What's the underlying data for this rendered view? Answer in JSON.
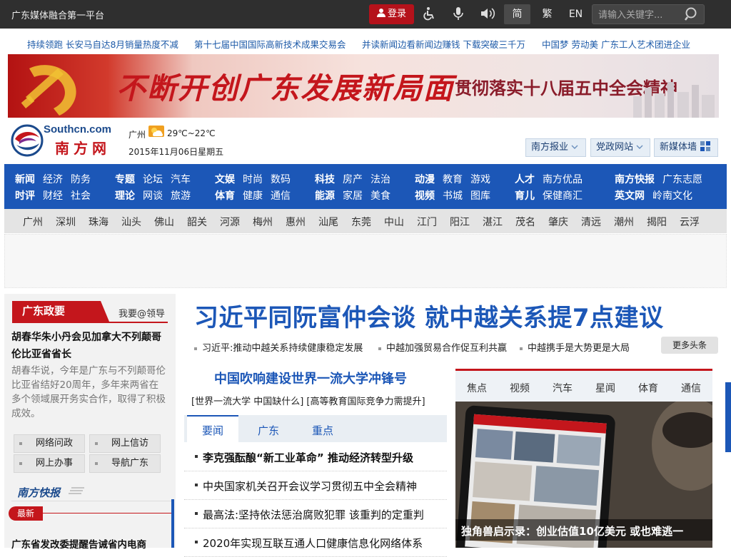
{
  "topbar": {
    "site_name": "广东媒体融合第一平台",
    "login_label": "登录",
    "icons": [
      "accessibility-icon",
      "microphone-icon",
      "speaker-icon"
    ],
    "lang_simplified": "简",
    "lang_traditional": "繁",
    "lang_english": "EN",
    "search_placeholder": "请输入关键字...",
    "bg_color": "#2f2f2f",
    "login_color": "#b5121b"
  },
  "ticker": [
    "持续领跑 长安马自达8月销量热度不减",
    "第十七届中国国际高新技术成果交易会",
    "并读新闻边看新闻边赚钱 下载突破三千万",
    "中国梦 劳动美 广东工人艺术团进企业"
  ],
  "banner": {
    "headline": "不断开创广东发展新局面",
    "subheadline": "贯彻落实十八届五中全会精神"
  },
  "logo": {
    "en": "Southcn.com",
    "cn": "南方网"
  },
  "weather": {
    "city": "广州",
    "temp": "29℃~22℃",
    "date": "2015年11月06日星期五"
  },
  "dropdowns": {
    "nanfang_newspaper": "南方报业",
    "party_sites": "党政网站",
    "new_media_wall": "新媒体墙"
  },
  "nav": {
    "groups": [
      {
        "row1": [
          "新闻",
          "经济",
          "防务"
        ],
        "row2": [
          "时评",
          "财经",
          "社会"
        ]
      },
      {
        "row1": [
          "专题",
          "论坛",
          "汽车"
        ],
        "row2": [
          "理论",
          "网谈",
          "旅游"
        ]
      },
      {
        "row1": [
          "文娱",
          "时尚",
          "数码"
        ],
        "row2": [
          "体育",
          "健康",
          "通信"
        ]
      },
      {
        "row1": [
          "科技",
          "房产",
          "法治"
        ],
        "row2": [
          "能源",
          "家居",
          "美食"
        ]
      },
      {
        "row1": [
          "动漫",
          "教育",
          "游戏"
        ],
        "row2": [
          "视频",
          "书城",
          "图库"
        ]
      },
      {
        "row1": [
          "人才",
          "南方优品"
        ],
        "row2": [
          "育儿",
          "保健商汇"
        ]
      },
      {
        "row1": [
          "南方快报",
          "广东志愿"
        ],
        "row2": [
          "英文网",
          "岭南文化"
        ]
      }
    ],
    "accent": "#1c57b7"
  },
  "cities": [
    "广州",
    "深圳",
    "珠海",
    "汕头",
    "佛山",
    "韶关",
    "河源",
    "梅州",
    "惠州",
    "汕尾",
    "东莞",
    "中山",
    "江门",
    "阳江",
    "湛江",
    "茂名",
    "肇庆",
    "清远",
    "潮州",
    "揭阳",
    "云浮"
  ],
  "left": {
    "policy_tab": "广东政要",
    "ask_leader": "我要@领导",
    "policy_title": "胡春华朱小丹会见加拿大不列颠哥伦比亚省省长",
    "policy_body": "胡春华说，今年是广东与不列颠哥伦比亚省结好20周年，多年来两省在多个领域展开务实合作，取得了积极成效。",
    "services": [
      "网络问政",
      "网上信访",
      "网上办事",
      "导航广东"
    ],
    "flash_title": "南方快报",
    "latest_tag": "最新",
    "flash_item": "广东省发改委提醒告诫省内电商"
  },
  "headline": {
    "main": "习近平同阮富仲会谈 就中越关系提7点建议",
    "subs": [
      "习近平:推动中越关系持续健康稳定发展",
      "中越加强贸易合作促互利共赢",
      "中越携手是大势更是大局"
    ],
    "more_label": "更多头条"
  },
  "middle": {
    "feature_title": "中国吹响建设世界一流大学冲锋号",
    "feature_sub": "[世界一流大学 中国缺什么] [高等教育国际竞争力需提升]",
    "tabs": [
      "要闻",
      "广东",
      "重点"
    ],
    "news": [
      "李克强酝酿“新工业革命” 推动经济转型升级",
      "中央国家机关召开会议学习贯彻五中全会精神",
      "最高法:坚持依法惩治腐败犯罪 该重判的定重判",
      "2020年实现互联互通人口健康信息化网络体系"
    ]
  },
  "right": {
    "tabs": [
      "焦点",
      "视频",
      "汽车",
      "星闻",
      "体育",
      "通信"
    ],
    "photo_caption": "独角兽启示录：创业估值10亿美元 或也难逃一",
    "tab_accent": "#c4161c"
  }
}
